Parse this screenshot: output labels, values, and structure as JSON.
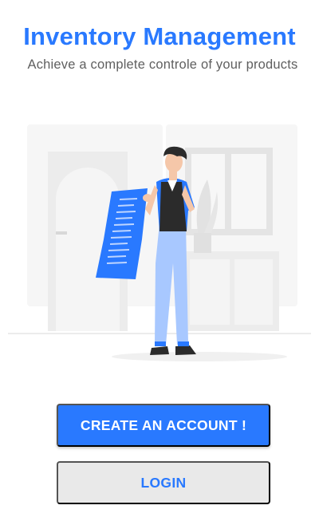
{
  "header": {
    "title": "Inventory Management",
    "subtitle": "Achieve a complete controle of your products"
  },
  "illustration": {
    "icon": "person-holding-receipt-illustration"
  },
  "actions": {
    "create_account_label": "CREATE AN ACCOUNT !",
    "login_label": "LOGIN"
  },
  "colors": {
    "accent": "#2979ff",
    "subtitle_text": "#5f5f5f",
    "secondary_button_bg": "#e9e9e9"
  }
}
